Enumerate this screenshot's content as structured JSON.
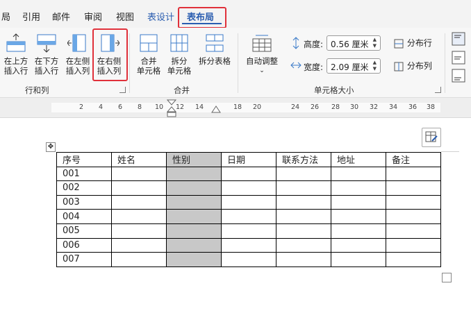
{
  "tabs": [
    "局",
    "引用",
    "邮件",
    "审阅",
    "视图",
    "表设计",
    "表布局"
  ],
  "ribbon": {
    "groups": {
      "rows_cols": {
        "label": "行和列",
        "buttons": [
          {
            "line1": "在上方",
            "line2": "插入行"
          },
          {
            "line1": "在下方",
            "line2": "插入行"
          },
          {
            "line1": "在左侧",
            "line2": "插入列"
          },
          {
            "line1": "在右侧",
            "line2": "插入列"
          }
        ]
      },
      "merge": {
        "label": "合并",
        "buttons": [
          {
            "line1": "合并",
            "line2": "单元格"
          },
          {
            "line1": "拆分",
            "line2": "单元格"
          },
          {
            "line1": "拆分表格",
            "line2": ""
          }
        ]
      },
      "cell_size": {
        "label": "单元格大小",
        "autofit": "自动调整",
        "height_label": "高度:",
        "height_value": "0.56 厘米",
        "width_label": "宽度:",
        "width_value": "2.09 厘米",
        "distribute_rows": "分布行",
        "distribute_cols": "分布列"
      }
    }
  },
  "ruler": {
    "numbers": [
      "2",
      "4",
      "6",
      "8",
      "10",
      "12",
      "14",
      "18",
      "20",
      "24",
      "26",
      "28",
      "30",
      "32",
      "34",
      "36",
      "38"
    ]
  },
  "table": {
    "headers": [
      "序号",
      "姓名",
      "性别",
      "日期",
      "联系方法",
      "地址",
      "备注"
    ],
    "rows": [
      "001",
      "002",
      "003",
      "004",
      "005",
      "006",
      "007"
    ],
    "shaded_column": "性别"
  },
  "colors": {
    "accent": "#2a5db0",
    "highlight_box": "#e0303a",
    "shaded_cell": "#c8c8c8"
  }
}
